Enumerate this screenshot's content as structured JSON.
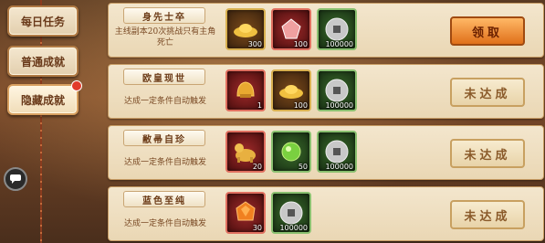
{
  "sidebar": {
    "tabs": [
      {
        "label": "每日任务"
      },
      {
        "label": "普通成就"
      },
      {
        "label": "隐藏成就"
      }
    ]
  },
  "achievements": [
    {
      "title": "身先士卒",
      "desc": "主线副本20次挑战只有主角死亡",
      "action": "领取",
      "rewards": [
        {
          "icon": "gold-ingot-icon",
          "color": "gold",
          "qty": "300"
        },
        {
          "icon": "red-gem-icon",
          "color": "red",
          "qty": "100"
        },
        {
          "icon": "coin-icon",
          "color": "green",
          "qty": "100000"
        }
      ]
    },
    {
      "title": "欧皇现世",
      "desc": "达成一定条件自动触发",
      "action": "未达成",
      "rewards": [
        {
          "icon": "golden-helmet-icon",
          "color": "red",
          "qty": "1"
        },
        {
          "icon": "gold-ingot-icon",
          "color": "gold",
          "qty": "100"
        },
        {
          "icon": "coin-icon",
          "color": "green",
          "qty": "100000"
        }
      ]
    },
    {
      "title": "敝帚自珍",
      "desc": "达成一定条件自动触发",
      "action": "未达成",
      "rewards": [
        {
          "icon": "golden-tiger-icon",
          "color": "red",
          "qty": "20"
        },
        {
          "icon": "green-orb-icon",
          "color": "green",
          "qty": "50"
        },
        {
          "icon": "coin-icon",
          "color": "green",
          "qty": "100000"
        }
      ]
    },
    {
      "title": "蓝色至纯",
      "desc": "达成一定条件自动触发",
      "action": "未达成",
      "rewards": [
        {
          "icon": "orange-gem-icon",
          "color": "red",
          "qty": "30"
        },
        {
          "icon": "coin-icon",
          "color": "green",
          "qty": "100000"
        }
      ]
    }
  ]
}
